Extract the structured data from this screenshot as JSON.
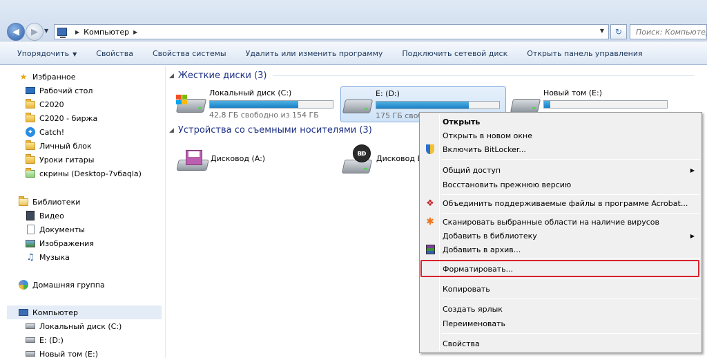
{
  "address": {
    "path_label": "Компьютер",
    "search_placeholder": "Поиск: Компьютер"
  },
  "toolbar": {
    "items": [
      "Упорядочить",
      "Свойства",
      "Свойства системы",
      "Удалить или изменить программу",
      "Подключить сетевой диск",
      "Открыть панель управления"
    ]
  },
  "sidebar": {
    "favorites": "Избранное",
    "fav_items": [
      "Рабочий стол",
      "C2020",
      "C2020 - биржа",
      "Catch!",
      "Личный блок",
      "Уроки гитары",
      "скрины (Desktop-7vбaqla)"
    ],
    "libraries": "Библиотеки",
    "lib_items": [
      "Видео",
      "Документы",
      "Изображения",
      "Музыка"
    ],
    "homegroup": "Домашняя группа",
    "computer": "Компьютер",
    "computer_items": [
      "Локальный диск (C:)",
      "E: (D:)",
      "Новый том (E:)"
    ]
  },
  "main": {
    "hdd_group": "Жесткие диски (3)",
    "removable_group": "Устройства со съемными носителями (3)",
    "drives": [
      {
        "name": "Локальный диск (C:)",
        "free": "42,8 ГБ свободно из 154 ГБ",
        "used_fraction": 0.72
      },
      {
        "name": "E: (D:)",
        "free": "175 ГБ свобо",
        "used_fraction": 0.75
      },
      {
        "name": "Новый том (E:)",
        "free": "",
        "used_fraction": 0.05
      }
    ],
    "removable": [
      {
        "name": "Дисковод (A:)"
      },
      {
        "name": "Дисковод B"
      }
    ],
    "bd_label": "BD"
  },
  "context_menu": {
    "items": [
      "Открыть",
      "Открыть в новом окне",
      "Включить BitLocker...",
      "Общий доступ",
      "Восстановить прежнюю версию",
      "Объединить поддерживаемые файлы в программе Acrobat...",
      "Сканировать выбранные области на наличие вирусов",
      "Добавить в библиотеку",
      "Добавить в архив...",
      "Форматировать...",
      "Копировать",
      "Создать ярлык",
      "Переименовать",
      "Свойства"
    ]
  },
  "colors": {
    "accent": "#1e3287",
    "highlight_border": "#d9232e",
    "bar_fill": "#1a80c4"
  }
}
